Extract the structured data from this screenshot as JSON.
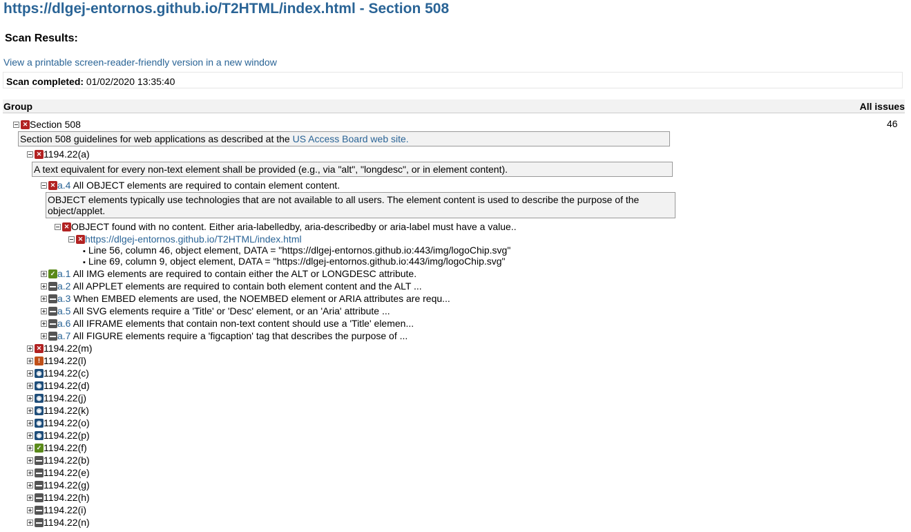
{
  "page": {
    "title": "https://dlgej-entornos.github.io/T2HTML/index.html - Section 508",
    "scan_results_heading": "Scan Results:",
    "printable_link": "View a printable screen-reader-friendly version in a new window",
    "scan_completed_label": "Scan completed:",
    "scan_completed_value": "01/02/2020 13:35:40"
  },
  "table": {
    "group_header": "Group",
    "issues_header": "All issues"
  },
  "section": {
    "name": "Section 508",
    "count": "46",
    "desc_prefix": "Section 508 guidelines for web applications as described at the ",
    "desc_link": "US Access Board web site."
  },
  "a": {
    "name": "1194.22(a)",
    "desc": "A text equivalent for every non-text element shall be provided (e.g., via \"alt\", \"longdesc\", or in element content).",
    "a4": {
      "id": "a.4",
      "text": "All OBJECT elements are required to contain element content.",
      "desc": "OBJECT elements typically use technologies that are not available to all users. The element content is used to describe the purpose of the object/applet.",
      "finding": "OBJECT found with no content. Either aria-labelledby, aria-describedby or aria-label must have a value..",
      "url": "https://dlgej-entornos.github.io/T2HTML/index.html",
      "lines": [
        "Line 56, column 46, object element, DATA = \"https://dlgej-entornos.github.io:443/img/logoChip.svg\"",
        "Line 69, column 9, object element, DATA = \"https://dlgej-entornos.github.io:443/img/logoChip.svg\""
      ]
    },
    "rules": [
      {
        "id": "a.1",
        "text": "All IMG elements are required to contain either the ALT or LONGDESC attribute.",
        "status": "pass"
      },
      {
        "id": "a.2",
        "text": "All APPLET elements are required to contain both element content and the ALT ...",
        "status": "na"
      },
      {
        "id": "a.3",
        "text": "When EMBED elements are used, the NOEMBED element or ARIA attributes are requ...",
        "status": "na"
      },
      {
        "id": "a.5",
        "text": "All SVG elements require a 'Title' or 'Desc' element, or an 'Aria' attribute ...",
        "status": "na"
      },
      {
        "id": "a.6",
        "text": "All IFRAME elements that contain non-text content should use a 'Title' elemen...",
        "status": "na"
      },
      {
        "id": "a.7",
        "text": "All FIGURE elements require a 'figcaption' tag that describes the purpose of ...",
        "status": "na"
      }
    ]
  },
  "groups": [
    {
      "name": "1194.22(m)",
      "status": "fail"
    },
    {
      "name": "1194.22(l)",
      "status": "warn"
    },
    {
      "name": "1194.22(c)",
      "status": "review"
    },
    {
      "name": "1194.22(d)",
      "status": "review"
    },
    {
      "name": "1194.22(j)",
      "status": "review"
    },
    {
      "name": "1194.22(k)",
      "status": "review"
    },
    {
      "name": "1194.22(o)",
      "status": "review"
    },
    {
      "name": "1194.22(p)",
      "status": "review"
    },
    {
      "name": "1194.22(f)",
      "status": "pass"
    },
    {
      "name": "1194.22(b)",
      "status": "na"
    },
    {
      "name": "1194.22(e)",
      "status": "na"
    },
    {
      "name": "1194.22(g)",
      "status": "na"
    },
    {
      "name": "1194.22(h)",
      "status": "na"
    },
    {
      "name": "1194.22(i)",
      "status": "na"
    },
    {
      "name": "1194.22(n)",
      "status": "na"
    }
  ],
  "colors": {
    "link": "#2a6496",
    "fail": "#b22222",
    "pass": "#5a8a1a",
    "warn": "#c0501a",
    "review": "#1f4e7a",
    "na": "#555555"
  }
}
